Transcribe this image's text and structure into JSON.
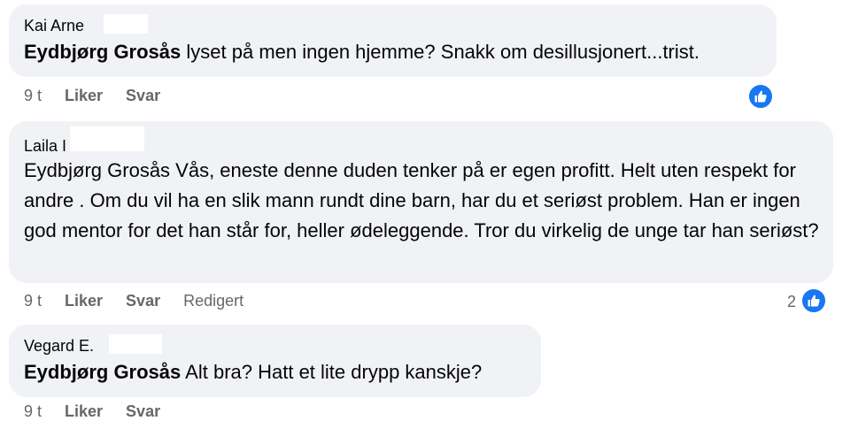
{
  "comments": [
    {
      "author": "Kai Arne",
      "mention": "Eydbjørg Grosås",
      "text": " lyset på men ingen hjemme? Snakk om desillusjonert...trist.",
      "time": "9 t",
      "like_label": "Liker",
      "reply_label": "Svar",
      "reaction_icon": "thumbs-up-icon"
    },
    {
      "author": "Laila I",
      "mention": "",
      "text": "Eydbjørg Grosås Vås, eneste denne duden tenker på er egen profitt. Helt uten respekt for andre . Om du vil ha en slik mann rundt dine barn, har du et seriøst problem. Han er ingen god mentor for det han står for, heller ødeleggende. Tror du virkelig de unge tar han seriøst?",
      "time": "9 t",
      "like_label": "Liker",
      "reply_label": "Svar",
      "edited_label": "Redigert",
      "reaction_count": "2",
      "reaction_icon": "thumbs-up-icon"
    },
    {
      "author": "Vegard E.",
      "mention": "Eydbjørg Grosås",
      "text": " Alt bra? Hatt et lite drypp kanskje?",
      "time": "9 t",
      "like_label": "Liker",
      "reply_label": "Svar"
    }
  ],
  "colors": {
    "bubble": "#f0f2f5",
    "meta_text": "#65676b",
    "like_blue": "#1877f2",
    "text": "#050505"
  }
}
